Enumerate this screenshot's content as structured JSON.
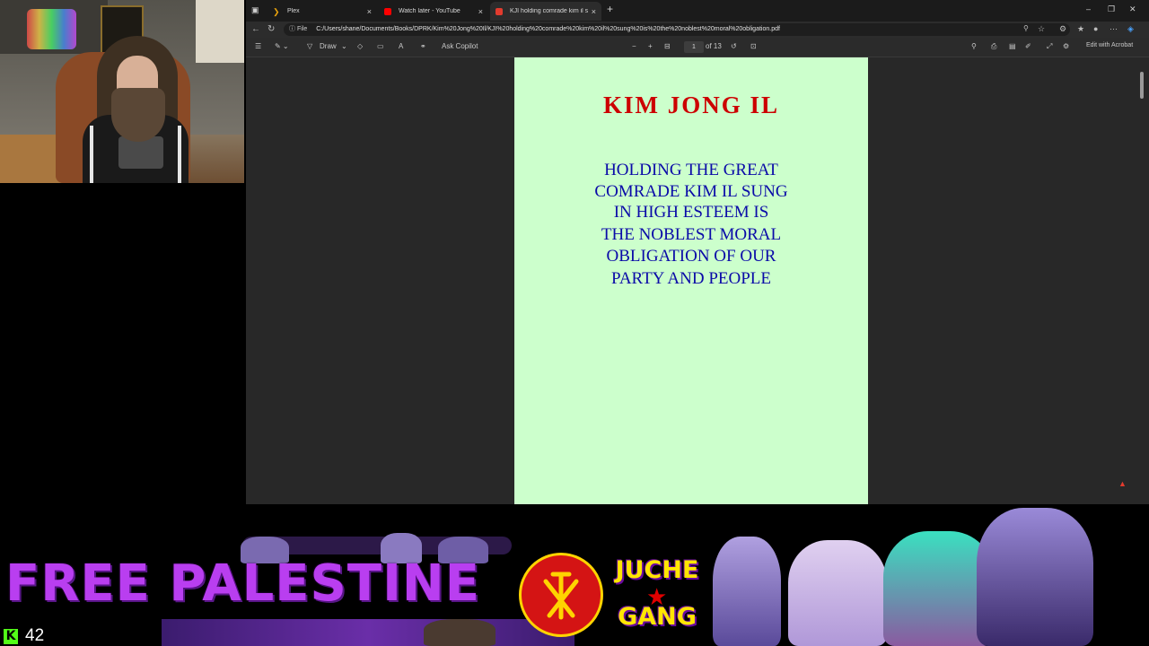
{
  "browser": {
    "tabs": [
      {
        "label": "Plex",
        "color": "#e5a00d"
      },
      {
        "label": "Watch later - YouTube",
        "color": "#ff0000"
      },
      {
        "label": "KJI holding comrade kim il sung",
        "color": "#e23b2e"
      }
    ],
    "url_scheme": "File",
    "url": "C:/Users/shane/Documents/Books/DPRK/Kim%20Jong%20Il/KJI%20holding%20comrade%20kim%20il%20sung%20is%20the%20noblest%20moral%20obligation.pdf"
  },
  "pdf_toolbar": {
    "draw_label": "Draw",
    "ask_copilot_label": "Ask Copilot",
    "page_current": "1",
    "page_total": "of 13",
    "edit_label": "Edit with Acrobat"
  },
  "document": {
    "author": "KIM JONG IL",
    "title_lines": [
      "HOLDING THE GREAT",
      "COMRADE KIM IL SUNG",
      "IN HIGH ESTEEM IS",
      "THE NOBLEST MORAL",
      "OBLIGATION OF OUR",
      "PARTY AND PEOPLE"
    ],
    "page_color": "#ccffcc",
    "author_color": "#cc0000",
    "title_color": "#0a0aa8"
  },
  "banner": {
    "headline": "FREE PALESTINE",
    "sticker_line1": "JUCHE",
    "sticker_line2": "GANG",
    "viewer_count": "42",
    "kick_glyph": "K",
    "headline_color": "#b93ef0",
    "kick_color": "#53fc18"
  }
}
